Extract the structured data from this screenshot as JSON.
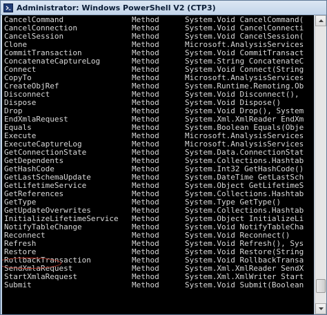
{
  "window": {
    "title": "Administrator: Windows PowerShell V2 (CTP3)"
  },
  "console": {
    "rows": [
      {
        "name": "CancelCommand",
        "type": "Method",
        "definition": "System.Void CancelCommand("
      },
      {
        "name": "CancelConnection",
        "type": "Method",
        "definition": "System.Void CancelConnecti"
      },
      {
        "name": "CancelSession",
        "type": "Method",
        "definition": "System.Void CancelSession("
      },
      {
        "name": "Clone",
        "type": "Method",
        "definition": "Microsoft.AnalysisServices"
      },
      {
        "name": "CommitTransaction",
        "type": "Method",
        "definition": "System.Void CommitTransact"
      },
      {
        "name": "ConcatenateCaptureLog",
        "type": "Method",
        "definition": "System.String ConcatenateC"
      },
      {
        "name": "Connect",
        "type": "Method",
        "definition": "System.Void Connect(String"
      },
      {
        "name": "CopyTo",
        "type": "Method",
        "definition": "Microsoft.AnalysisServices"
      },
      {
        "name": "CreateObjRef",
        "type": "Method",
        "definition": "System.Runtime.Remoting.Ob"
      },
      {
        "name": "Disconnect",
        "type": "Method",
        "definition": "System.Void Disconnect(),"
      },
      {
        "name": "Dispose",
        "type": "Method",
        "definition": "System.Void Dispose()"
      },
      {
        "name": "Drop",
        "type": "Method",
        "definition": "System.Void Drop(), System"
      },
      {
        "name": "EndXmlaRequest",
        "type": "Method",
        "definition": "System.Xml.XmlReader EndXm"
      },
      {
        "name": "Equals",
        "type": "Method",
        "definition": "System.Boolean Equals(Obje"
      },
      {
        "name": "Execute",
        "type": "Method",
        "definition": "Microsoft.AnalysisServices"
      },
      {
        "name": "ExecuteCaptureLog",
        "type": "Method",
        "definition": "Microsoft.AnalysisServices"
      },
      {
        "name": "GetConnectionState",
        "type": "Method",
        "definition": "System.Data.ConnectionStat"
      },
      {
        "name": "GetDependents",
        "type": "Method",
        "definition": "System.Collections.Hashtab"
      },
      {
        "name": "GetHashCode",
        "type": "Method",
        "definition": "System.Int32 GetHashCode()"
      },
      {
        "name": "GetLastSchemaUpdate",
        "type": "Method",
        "definition": "System.DateTime GetLastSch"
      },
      {
        "name": "GetLifetimeService",
        "type": "Method",
        "definition": "System.Object GetLifetimeS"
      },
      {
        "name": "GetReferences",
        "type": "Method",
        "definition": "System.Collections.Hashtab"
      },
      {
        "name": "GetType",
        "type": "Method",
        "definition": "System.Type GetType()"
      },
      {
        "name": "GetUpdateOverwrites",
        "type": "Method",
        "definition": "System.Collections.Hashtab"
      },
      {
        "name": "InitializeLifetimeService",
        "type": "Method",
        "definition": "System.Object InitializeLi"
      },
      {
        "name": "NotifyTableChange",
        "type": "Method",
        "definition": "System.Void NotifyTableCha"
      },
      {
        "name": "Reconnect",
        "type": "Method",
        "definition": "System.Void Reconnect()"
      },
      {
        "name": "Refresh",
        "type": "Method",
        "definition": "System.Void Refresh(), Sys"
      },
      {
        "name": "Restore",
        "type": "Method",
        "definition": "System.Void Restore(String"
      },
      {
        "name": "RollbackTransaction",
        "type": "Method",
        "definition": "System.Void RollbackTransa"
      },
      {
        "name": "SendXmlaRequest",
        "type": "Method",
        "definition": "System.Xml.XmlReader SendX"
      },
      {
        "name": "StartXmlaRequest",
        "type": "Method",
        "definition": "System.Xml.XmlWriter Start"
      },
      {
        "name": "Submit",
        "type": "Method",
        "definition": "System.Void Submit(Boolean"
      }
    ]
  },
  "scrollbar": {
    "position": 0.96
  },
  "colors": {
    "console_background": "#000000",
    "console_text": "#d8d8d8",
    "highlight_oval": "#c0392b"
  }
}
